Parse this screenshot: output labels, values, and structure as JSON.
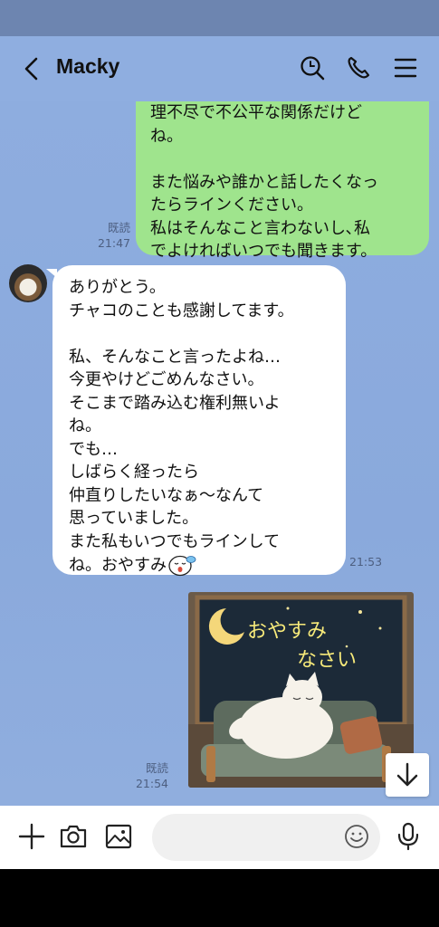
{
  "header": {
    "title": "Macky"
  },
  "messages": {
    "sent_text": [
      "理不尽で不公平な関係だけど",
      "ね。",
      "",
      "また悩みや誰かと話したくなっ",
      "たらラインください。",
      "私はそんなこと言わないし､私",
      "でよければいつでも聞きます。"
    ],
    "sent_read": "既読",
    "sent_time": "21:47",
    "received_text": [
      "ありがとう。",
      "チャコのことも感謝してます。",
      "",
      "私、そんなこと言ったよね…",
      "今更やけどごめんなさい。",
      "そこまで踏み込む権利無いよ",
      "ね。",
      "でも…",
      "しばらく経ったら",
      "仲直りしたいなぁ～なんて",
      "思っていました。",
      "また私もいつでもラインして"
    ],
    "received_last_line": "ね。おやすみ",
    "received_time": "21:53",
    "sticker_text_1": "おやすみ",
    "sticker_text_2": "なさい",
    "sticker_read": "既読",
    "sticker_time": "21:54"
  },
  "icons": {
    "back": "chevron-left-icon",
    "search": "search-icon",
    "call": "phone-icon",
    "menu": "menu-icon",
    "add": "plus-icon",
    "camera": "camera-icon",
    "gallery": "image-icon",
    "emoji": "smiley-icon",
    "mic": "microphone-icon",
    "scroll": "arrow-down-icon"
  },
  "colors": {
    "chat_bg": "#8eaddf",
    "sent_bubble": "#9fe48d",
    "received_bubble": "#ffffff"
  }
}
